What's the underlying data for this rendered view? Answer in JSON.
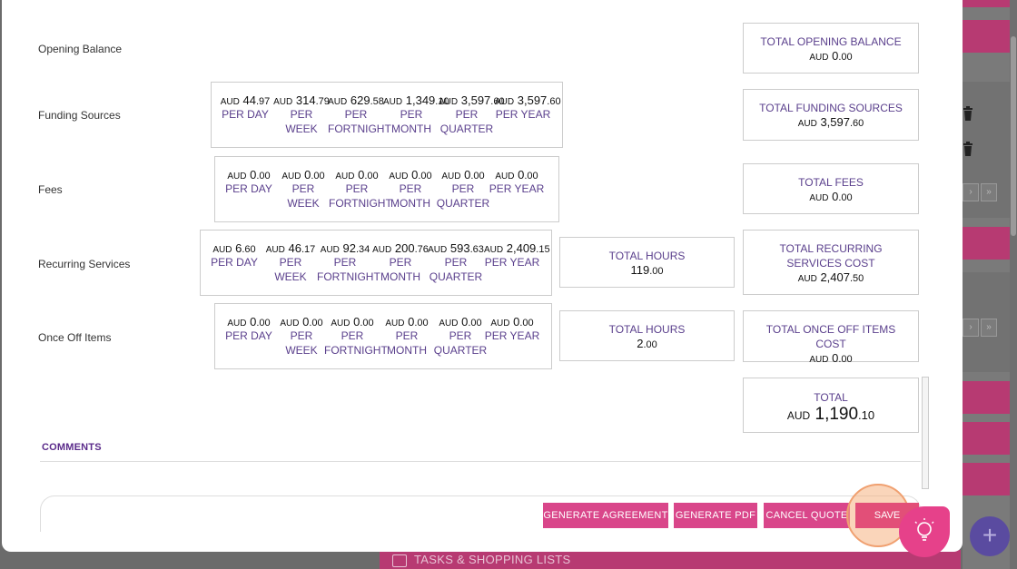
{
  "rows": {
    "opening_balance": {
      "label": "Opening Balance"
    },
    "funding_sources": {
      "label": "Funding Sources",
      "cells": [
        {
          "cur": "AUD",
          "whole": "44",
          "cents": ".97",
          "per": "PER DAY"
        },
        {
          "cur": "AUD",
          "whole": "314",
          "cents": ".79",
          "per": "PER WEEK"
        },
        {
          "cur": "AUD",
          "whole": "629",
          "cents": ".58",
          "per": "PER FORTNIGHT"
        },
        {
          "cur": "AUD",
          "whole": "1,349",
          "cents": ".10",
          "per": "PER MONTH"
        },
        {
          "cur": "AUD",
          "whole": "3,597",
          "cents": ".60",
          "per": "PER QUARTER"
        },
        {
          "cur": "AUD",
          "whole": "3,597",
          "cents": ".60",
          "per": "PER YEAR"
        }
      ]
    },
    "fees": {
      "label": "Fees",
      "cells": [
        {
          "cur": "AUD",
          "whole": "0",
          "cents": ".00",
          "per": "PER DAY"
        },
        {
          "cur": "AUD",
          "whole": "0",
          "cents": ".00",
          "per": "PER WEEK"
        },
        {
          "cur": "AUD",
          "whole": "0",
          "cents": ".00",
          "per": "PER FORTNIGHT"
        },
        {
          "cur": "AUD",
          "whole": "0",
          "cents": ".00",
          "per": "PER MONTH"
        },
        {
          "cur": "AUD",
          "whole": "0",
          "cents": ".00",
          "per": "PER QUARTER"
        },
        {
          "cur": "AUD",
          "whole": "0",
          "cents": ".00",
          "per": "PER YEAR"
        }
      ]
    },
    "recurring_services": {
      "label": "Recurring Services",
      "cells": [
        {
          "cur": "AUD",
          "whole": "6",
          "cents": ".60",
          "per": "PER DAY"
        },
        {
          "cur": "AUD",
          "whole": "46",
          "cents": ".17",
          "per": "PER WEEK"
        },
        {
          "cur": "AUD",
          "whole": "92",
          "cents": ".34",
          "per": "PER FORTNIGHT"
        },
        {
          "cur": "AUD",
          "whole": "200",
          "cents": ".76",
          "per": "PER MONTH"
        },
        {
          "cur": "AUD",
          "whole": "593",
          "cents": ".63",
          "per": "PER QUARTER"
        },
        {
          "cur": "AUD",
          "whole": "2,409",
          "cents": ".15",
          "per": "PER YEAR"
        }
      ]
    },
    "once_off_items": {
      "label": "Once Off Items",
      "cells": [
        {
          "cur": "AUD",
          "whole": "0",
          "cents": ".00",
          "per": "PER DAY"
        },
        {
          "cur": "AUD",
          "whole": "0",
          "cents": ".00",
          "per": "PER WEEK"
        },
        {
          "cur": "AUD",
          "whole": "0",
          "cents": ".00",
          "per": "PER FORTNIGHT"
        },
        {
          "cur": "AUD",
          "whole": "0",
          "cents": ".00",
          "per": "PER MONTH"
        },
        {
          "cur": "AUD",
          "whole": "0",
          "cents": ".00",
          "per": "PER QUARTER"
        },
        {
          "cur": "AUD",
          "whole": "0",
          "cents": ".00",
          "per": "PER YEAR"
        }
      ]
    }
  },
  "totals": {
    "opening_balance": {
      "label": "TOTAL OPENING BALANCE",
      "cur": "AUD",
      "whole": "0",
      "cents": ".00"
    },
    "funding_sources": {
      "label": "TOTAL FUNDING SOURCES",
      "cur": "AUD",
      "whole": "3,597",
      "cents": ".60"
    },
    "fees": {
      "label": "TOTAL FEES",
      "cur": "AUD",
      "whole": "0",
      "cents": ".00"
    },
    "recurring_hours": {
      "label": "TOTAL HOURS",
      "whole": "119",
      "cents": ".00"
    },
    "recurring_cost": {
      "label": "TOTAL RECURRING SERVICES COST",
      "cur": "AUD",
      "whole": "2,407",
      "cents": ".50"
    },
    "once_off_hours": {
      "label": "TOTAL HOURS",
      "whole": "2",
      "cents": ".00"
    },
    "once_off_cost": {
      "label": "TOTAL ONCE OFF ITEMS COST",
      "cur": "AUD",
      "whole": "0",
      "cents": ".00"
    },
    "grand_total": {
      "label": "TOTAL",
      "cur": "AUD",
      "whole": "1,190",
      "cents": ".10"
    }
  },
  "comments": {
    "label": "COMMENTS"
  },
  "buttons": {
    "generate_agreement": "GENERATE AGREEMENT",
    "generate_pdf": "GENERATE PDF",
    "cancel_quote": "CANCEL QUOTE",
    "save": "SAVE"
  },
  "background": {
    "bottom_bar_label": "TASKS & SHOPPING LISTS",
    "pager_next": "›",
    "pager_last": "»"
  },
  "icons": {
    "trash": "trash-icon",
    "bulb": "lightbulb-icon",
    "plus": "plus-icon"
  },
  "colors": {
    "accent": "#d9468a",
    "label_purple": "#5a3f8c",
    "save": "#e24f78",
    "fab_plus": "#5a4ba0"
  }
}
